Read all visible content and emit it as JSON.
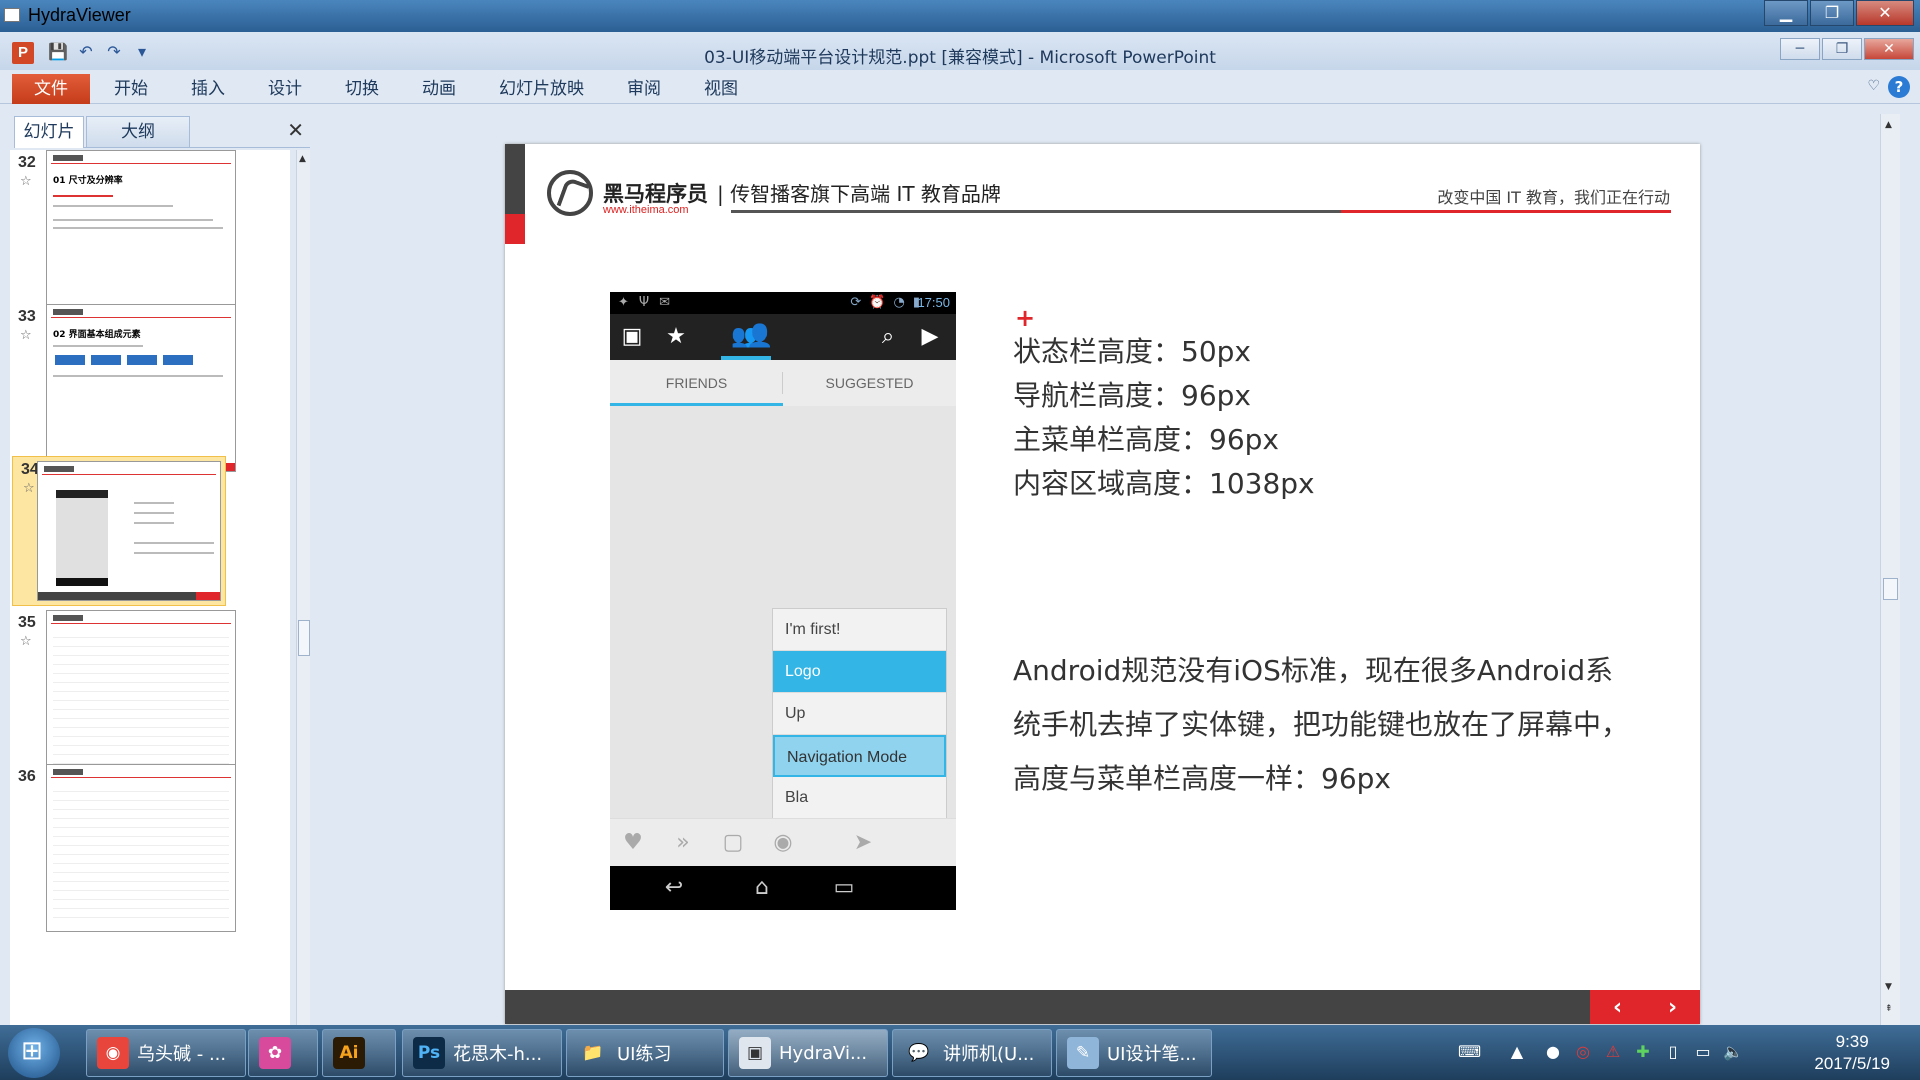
{
  "outer_window": {
    "app_name": "HydraViewer",
    "minimize": "▁",
    "maximize": "❐",
    "close": "✕"
  },
  "ppt_window": {
    "logo_letter": "P",
    "doc_title": "03-UI移动端平台设计规范.ppt [兼容模式]  -  Microsoft PowerPoint",
    "qat": {
      "save_icon": "💾",
      "undo_icon": "↶",
      "redo_icon": "↷",
      "customize_icon": "▾"
    },
    "controls": {
      "minimize": "─",
      "restore": "❐",
      "close": "✕"
    }
  },
  "ribbon": {
    "file_tab": "文件",
    "tabs": [
      "开始",
      "插入",
      "设计",
      "切换",
      "动画",
      "幻灯片放映",
      "审阅",
      "视图"
    ],
    "help": "?",
    "minimize_ribbon": "♡"
  },
  "slide_panel": {
    "tab_slides": "幻灯片",
    "tab_outline": "大纲",
    "close": "✕",
    "thumbnails": [
      {
        "number": "32",
        "title": "01 尺寸及分辨率"
      },
      {
        "number": "33",
        "title": "02 界面基本组成元素"
      },
      {
        "number": "34",
        "title": ""
      },
      {
        "number": "35",
        "title": ""
      },
      {
        "number": "36",
        "title": ""
      }
    ]
  },
  "slide": {
    "brand_name": "黑马程序员",
    "brand_url": "www.itheima.com",
    "brand_tagline": "| 传智播客旗下高端 IT 教育品牌",
    "slogan": "改变中国 IT 教育，我们正在行动",
    "plus_mark": "+",
    "specs": [
      "状态栏高度：50px",
      "导航栏高度：96px",
      "主菜单栏高度：96px",
      "内容区域高度：1038px"
    ],
    "description_lines": [
      "Android规范没有iOS标准，现在很多Android系",
      "统手机去掉了实体键，把功能键也放在了屏幕中，",
      "高度与菜单栏高度一样：96px"
    ],
    "footer_prev": "‹",
    "footer_next": "›"
  },
  "phone": {
    "status_time": "17:50",
    "tab_friends": "FRIENDS",
    "tab_suggested": "SUGGESTED",
    "menu_items": [
      "I'm first!",
      "Logo",
      "Up",
      "Navigation Mode",
      "Bla"
    ]
  },
  "taskbar": {
    "items": [
      {
        "label": "乌头碱 - ...",
        "icon_text": "◉",
        "icon_color": "#e8453c"
      },
      {
        "label": "",
        "icon_text": "✿",
        "icon_color": "#d84a9b"
      },
      {
        "label": "",
        "icon_text": "Ai",
        "icon_color": "#2b1a04"
      },
      {
        "label": "花思木-h...",
        "icon_text": "Ps",
        "icon_color": "#0d2a47"
      },
      {
        "label": "UI练习",
        "icon_text": "📁",
        "icon_color": "#e9c46a"
      },
      {
        "label": "HydraVi...",
        "icon_text": "▣",
        "icon_color": "#dfe6ee"
      },
      {
        "label": "讲师机(U...",
        "icon_text": "💬",
        "icon_color": "#f2c233"
      },
      {
        "label": "UI设计笔...",
        "icon_text": "✎",
        "icon_color": "#8fb5d8"
      }
    ],
    "clock_time": "9:39",
    "clock_date": "2017/5/19"
  }
}
